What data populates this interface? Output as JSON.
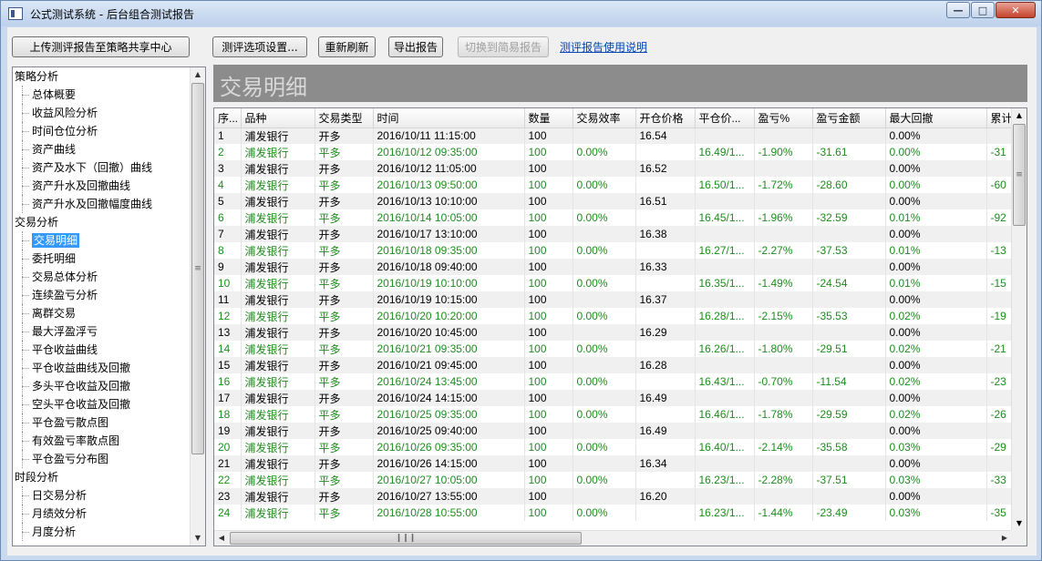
{
  "window": {
    "title": "公式测试系统 - 后台组合测试报告"
  },
  "toolbar": {
    "upload": "上传测评报告至策略共享中心",
    "options": "测评选项设置...",
    "refresh": "重新刷新",
    "export": "导出报告",
    "switch_simple": "切换到简易报告",
    "help_link": "测评报告使用说明"
  },
  "tree": [
    {
      "type": "cat",
      "label": "策略分析"
    },
    {
      "type": "leaf",
      "label": "总体概要"
    },
    {
      "type": "leaf",
      "label": "收益风险分析"
    },
    {
      "type": "leaf",
      "label": "时间仓位分析"
    },
    {
      "type": "leaf",
      "label": "资产曲线"
    },
    {
      "type": "leaf",
      "label": "资产及水下（回撤）曲线"
    },
    {
      "type": "leaf",
      "label": "资产升水及回撤曲线"
    },
    {
      "type": "leaf",
      "label": "资产升水及回撤幅度曲线"
    },
    {
      "type": "cat",
      "label": "交易分析"
    },
    {
      "type": "leaf",
      "label": "交易明细",
      "selected": true
    },
    {
      "type": "leaf",
      "label": "委托明细"
    },
    {
      "type": "leaf",
      "label": "交易总体分析"
    },
    {
      "type": "leaf",
      "label": "连续盈亏分析"
    },
    {
      "type": "leaf",
      "label": "离群交易"
    },
    {
      "type": "leaf",
      "label": "最大浮盈浮亏"
    },
    {
      "type": "leaf",
      "label": "平仓收益曲线"
    },
    {
      "type": "leaf",
      "label": "平仓收益曲线及回撤"
    },
    {
      "type": "leaf",
      "label": "多头平仓收益及回撤"
    },
    {
      "type": "leaf",
      "label": "空头平仓收益及回撤"
    },
    {
      "type": "leaf",
      "label": "平仓盈亏散点图"
    },
    {
      "type": "leaf",
      "label": "有效盈亏率散点图"
    },
    {
      "type": "leaf",
      "label": "平仓盈亏分布图"
    },
    {
      "type": "cat",
      "label": "时段分析"
    },
    {
      "type": "leaf",
      "label": "日交易分析"
    },
    {
      "type": "leaf",
      "label": "月绩效分析"
    },
    {
      "type": "leaf",
      "label": "月度分析"
    }
  ],
  "report": {
    "title": "交易明细",
    "columns": [
      "序...",
      "品种",
      "交易类型",
      "时间",
      "数量",
      "交易效率",
      "开仓价格",
      "平仓价...",
      "盈亏%",
      "盈亏金额",
      "最大回撤",
      "累计"
    ],
    "rows": [
      [
        "1",
        "浦发银行",
        "开多",
        "2016/10/11 11:15:00",
        "100",
        "",
        "16.54",
        "",
        "",
        "",
        "0.00%",
        ""
      ],
      [
        "2",
        "浦发银行",
        "平多",
        "2016/10/12 09:35:00",
        "100",
        "0.00%",
        "",
        "16.49/1...",
        "-1.90%",
        "-31.61",
        "0.00%",
        "-31"
      ],
      [
        "3",
        "浦发银行",
        "开多",
        "2016/10/12 11:05:00",
        "100",
        "",
        "16.52",
        "",
        "",
        "",
        "0.00%",
        ""
      ],
      [
        "4",
        "浦发银行",
        "平多",
        "2016/10/13 09:50:00",
        "100",
        "0.00%",
        "",
        "16.50/1...",
        "-1.72%",
        "-28.60",
        "0.00%",
        "-60"
      ],
      [
        "5",
        "浦发银行",
        "开多",
        "2016/10/13 10:10:00",
        "100",
        "",
        "16.51",
        "",
        "",
        "",
        "0.00%",
        ""
      ],
      [
        "6",
        "浦发银行",
        "平多",
        "2016/10/14 10:05:00",
        "100",
        "0.00%",
        "",
        "16.45/1...",
        "-1.96%",
        "-32.59",
        "0.01%",
        "-92"
      ],
      [
        "7",
        "浦发银行",
        "开多",
        "2016/10/17 13:10:00",
        "100",
        "",
        "16.38",
        "",
        "",
        "",
        "0.00%",
        ""
      ],
      [
        "8",
        "浦发银行",
        "平多",
        "2016/10/18 09:35:00",
        "100",
        "0.00%",
        "",
        "16.27/1...",
        "-2.27%",
        "-37.53",
        "0.01%",
        "-13"
      ],
      [
        "9",
        "浦发银行",
        "开多",
        "2016/10/18 09:40:00",
        "100",
        "",
        "16.33",
        "",
        "",
        "",
        "0.00%",
        ""
      ],
      [
        "10",
        "浦发银行",
        "平多",
        "2016/10/19 10:10:00",
        "100",
        "0.00%",
        "",
        "16.35/1...",
        "-1.49%",
        "-24.54",
        "0.01%",
        "-15"
      ],
      [
        "11",
        "浦发银行",
        "开多",
        "2016/10/19 10:15:00",
        "100",
        "",
        "16.37",
        "",
        "",
        "",
        "0.00%",
        ""
      ],
      [
        "12",
        "浦发银行",
        "平多",
        "2016/10/20 10:20:00",
        "100",
        "0.00%",
        "",
        "16.28/1...",
        "-2.15%",
        "-35.53",
        "0.02%",
        "-19"
      ],
      [
        "13",
        "浦发银行",
        "开多",
        "2016/10/20 10:45:00",
        "100",
        "",
        "16.29",
        "",
        "",
        "",
        "0.00%",
        ""
      ],
      [
        "14",
        "浦发银行",
        "平多",
        "2016/10/21 09:35:00",
        "100",
        "0.00%",
        "",
        "16.26/1...",
        "-1.80%",
        "-29.51",
        "0.02%",
        "-21"
      ],
      [
        "15",
        "浦发银行",
        "开多",
        "2016/10/21 09:45:00",
        "100",
        "",
        "16.28",
        "",
        "",
        "",
        "0.00%",
        ""
      ],
      [
        "16",
        "浦发银行",
        "平多",
        "2016/10/24 13:45:00",
        "100",
        "0.00%",
        "",
        "16.43/1...",
        "-0.70%",
        "-11.54",
        "0.02%",
        "-23"
      ],
      [
        "17",
        "浦发银行",
        "开多",
        "2016/10/24 14:15:00",
        "100",
        "",
        "16.49",
        "",
        "",
        "",
        "0.00%",
        ""
      ],
      [
        "18",
        "浦发银行",
        "平多",
        "2016/10/25 09:35:00",
        "100",
        "0.00%",
        "",
        "16.46/1...",
        "-1.78%",
        "-29.59",
        "0.02%",
        "-26"
      ],
      [
        "19",
        "浦发银行",
        "开多",
        "2016/10/25 09:40:00",
        "100",
        "",
        "16.49",
        "",
        "",
        "",
        "0.00%",
        ""
      ],
      [
        "20",
        "浦发银行",
        "平多",
        "2016/10/26 09:35:00",
        "100",
        "0.00%",
        "",
        "16.40/1...",
        "-2.14%",
        "-35.58",
        "0.03%",
        "-29"
      ],
      [
        "21",
        "浦发银行",
        "开多",
        "2016/10/26 14:15:00",
        "100",
        "",
        "16.34",
        "",
        "",
        "",
        "0.00%",
        ""
      ],
      [
        "22",
        "浦发银行",
        "平多",
        "2016/10/27 10:05:00",
        "100",
        "0.00%",
        "",
        "16.23/1...",
        "-2.28%",
        "-37.51",
        "0.03%",
        "-33"
      ],
      [
        "23",
        "浦发银行",
        "开多",
        "2016/10/27 13:55:00",
        "100",
        "",
        "16.20",
        "",
        "",
        "",
        "0.00%",
        ""
      ],
      [
        "24",
        "浦发银行",
        "平多",
        "2016/10/28 10:55:00",
        "100",
        "0.00%",
        "",
        "16.23/1...",
        "-1.44%",
        "-23.49",
        "0.03%",
        "-35"
      ]
    ]
  }
}
